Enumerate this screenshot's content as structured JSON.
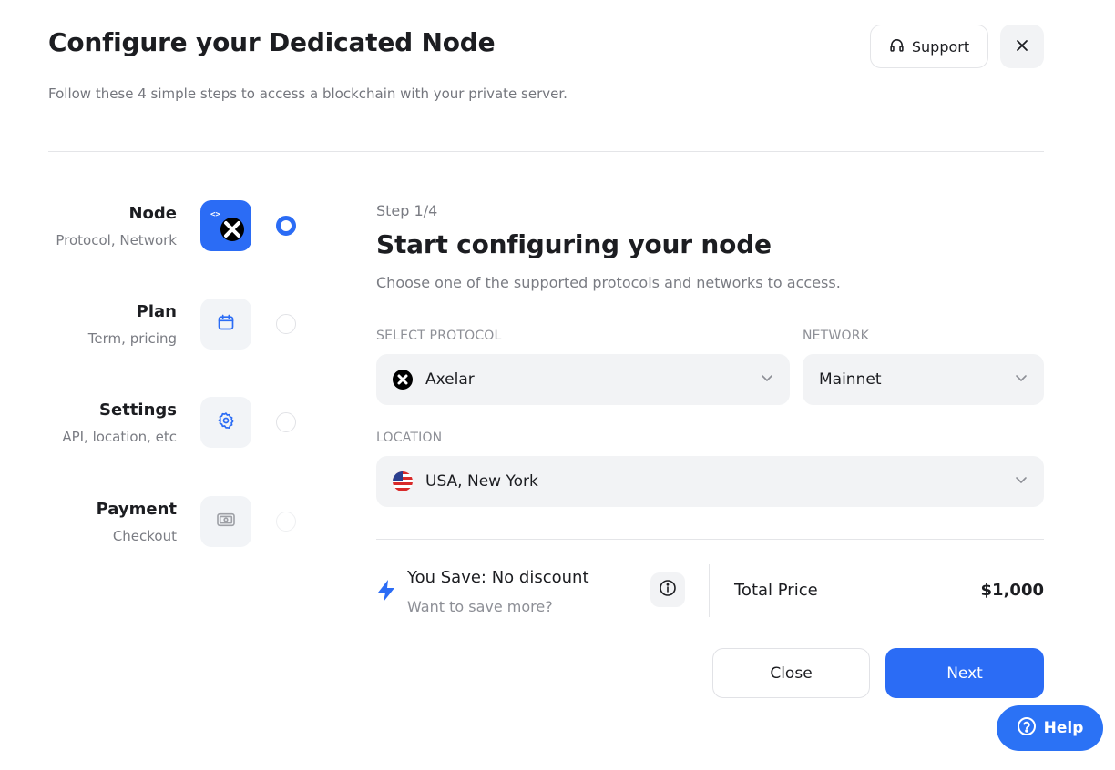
{
  "header": {
    "title": "Configure your Dedicated Node",
    "subtitle": "Follow these 4 simple steps to access a blockchain with your private server.",
    "support_label": "Support"
  },
  "steps": [
    {
      "label": "Node",
      "sub": "Protocol, Network",
      "icon": "node-protocol-icon",
      "active": true
    },
    {
      "label": "Plan",
      "sub": "Term, pricing",
      "icon": "calendar-icon",
      "active": false
    },
    {
      "label": "Settings",
      "sub": "API, location, etc",
      "icon": "gear-icon",
      "active": false
    },
    {
      "label": "Payment",
      "sub": "Checkout",
      "icon": "banknote-icon",
      "active": false
    }
  ],
  "main": {
    "step_counter": "Step 1/4",
    "heading": "Start configuring your node",
    "description": "Choose one of the supported protocols and networks to access.",
    "protocol": {
      "label": "SELECT PROTOCOL",
      "value": "Axelar"
    },
    "network": {
      "label": "NETWORK",
      "value": "Mainnet"
    },
    "location": {
      "label": "LOCATION",
      "value": "USA, New York"
    }
  },
  "summary": {
    "save_title": "You Save: No discount",
    "save_sub": "Want to save more?",
    "total_label": "Total Price",
    "total_value": "$1,000"
  },
  "actions": {
    "close_label": "Close",
    "next_label": "Next"
  },
  "help": {
    "label": "Help"
  },
  "colors": {
    "accent": "#2b6cf5",
    "field_bg": "#f2f3f5"
  }
}
